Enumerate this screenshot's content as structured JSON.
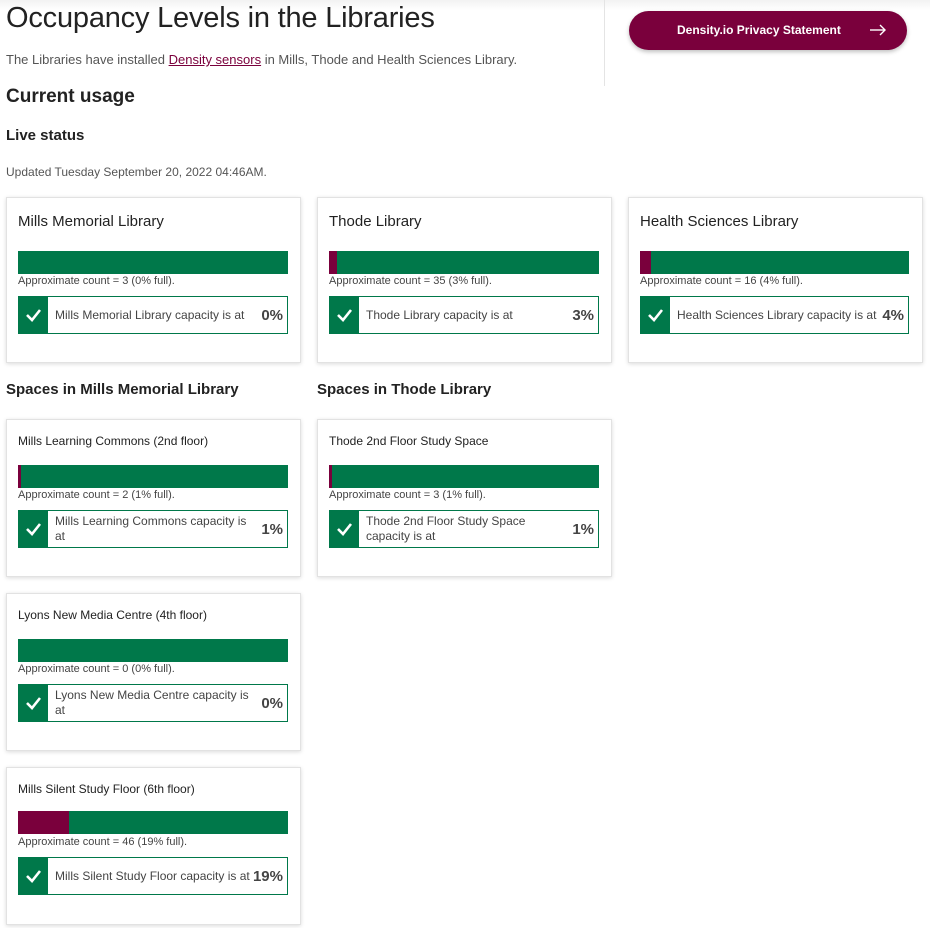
{
  "header": {
    "title": "Occupancy Levels in the Libraries",
    "intro_before": "The Libraries have installed ",
    "intro_link": "Density sensors",
    "intro_after": " in Mills, Thode and Health Sciences Library.",
    "privacy_button": "Density.io Privacy Statement"
  },
  "current_usage": "Current usage",
  "live_status": "Live status",
  "updated": "Updated Tuesday September 20, 2022 04:46AM.",
  "colors": {
    "brand_maroon": "#7a003c",
    "available_green": "#00784a"
  },
  "libraries": [
    {
      "name": "Mills Memorial Library",
      "count_text": "Approximate count = 3 (0% full).",
      "fill_percent": 0,
      "status_text": "Mills Memorial Library capacity is at",
      "status_pct": "0%"
    },
    {
      "name": "Thode Library",
      "count_text": "Approximate count = 35 (3% full).",
      "fill_percent": 3,
      "status_text": "Thode Library capacity is at",
      "status_pct": "3%"
    },
    {
      "name": "Health Sciences Library",
      "count_text": "Approximate count = 16 (4% full).",
      "fill_percent": 4,
      "status_text": "Health Sciences Library capacity is at",
      "status_pct": "4%"
    }
  ],
  "mills_spaces_heading": "Spaces in Mills Memorial Library",
  "thode_spaces_heading": "Spaces in Thode Library",
  "mills_spaces": [
    {
      "name": "Mills Learning Commons (2nd floor)",
      "count_text": "Approximate count = 2 (1% full).",
      "fill_percent": 1,
      "status_text": "Mills Learning Commons capacity is at",
      "status_pct": "1%"
    },
    {
      "name": "Lyons New Media Centre (4th floor)",
      "count_text": "Approximate count = 0 (0% full).",
      "fill_percent": 0,
      "status_text": "Lyons New Media Centre capacity is at",
      "status_pct": "0%"
    },
    {
      "name": "Mills Silent Study Floor (6th floor)",
      "count_text": "Approximate count = 46 (19% full).",
      "fill_percent": 19,
      "status_text": "Mills Silent Study Floor capacity is at",
      "status_pct": "19%"
    }
  ],
  "thode_spaces": [
    {
      "name": "Thode 2nd Floor Study Space",
      "count_text": "Approximate count = 3 (1% full).",
      "fill_percent": 1,
      "status_text": "Thode 2nd Floor Study Space capacity is at",
      "status_pct": "1%"
    }
  ],
  "icons": {
    "status": "checkmark-icon",
    "privacy_button": "arrow-right-icon"
  }
}
